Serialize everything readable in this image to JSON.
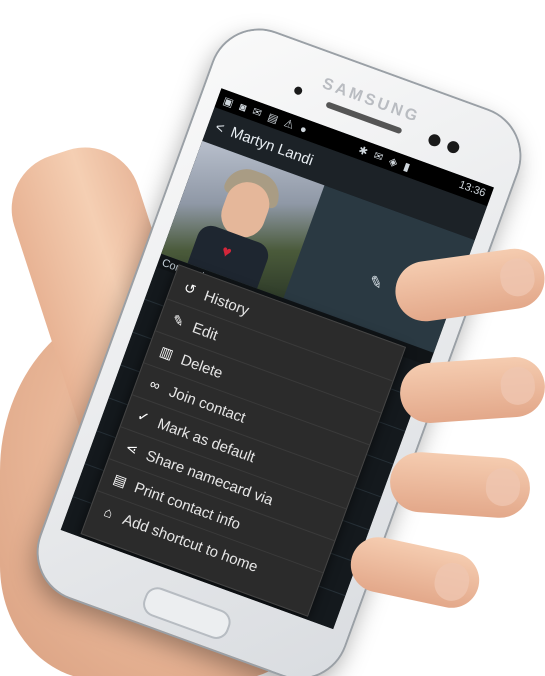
{
  "phone": {
    "brand": "SAMSUNG"
  },
  "status_bar": {
    "icons": "▣ ◙ ✉ ▤ ⚠ ●",
    "right_icons": "✱ ✉ ◈ ▮",
    "time": "13:36"
  },
  "action_bar": {
    "back_glyph": "<",
    "title": "Martyn Landi"
  },
  "header": {
    "edit_icon": "pencil-icon",
    "star_icon": "star-icon",
    "section_label": "Connections"
  },
  "menu": {
    "items": [
      {
        "icon": "history-icon",
        "glyph": "↺",
        "label": "History"
      },
      {
        "icon": "pencil-icon",
        "glyph": "✎",
        "label": "Edit"
      },
      {
        "icon": "trash-icon",
        "glyph": "▥",
        "label": "Delete"
      },
      {
        "icon": "link-icon",
        "glyph": "∞",
        "label": "Join contact"
      },
      {
        "icon": "check-icon",
        "glyph": "✓",
        "label": "Mark as default"
      },
      {
        "icon": "share-icon",
        "glyph": "⋖",
        "label": "Share namecard via"
      },
      {
        "icon": "print-icon",
        "glyph": "▤",
        "label": "Print contact info"
      },
      {
        "icon": "home-icon",
        "glyph": "⌂",
        "label": "Add shortcut to home"
      }
    ]
  }
}
